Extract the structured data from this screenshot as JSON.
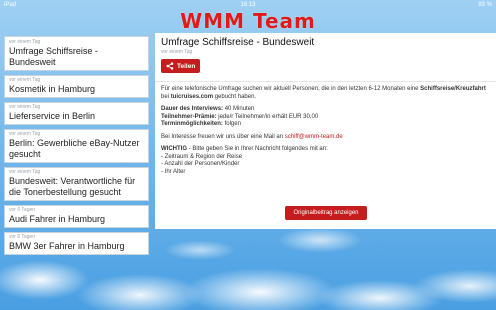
{
  "status": {
    "left": "iPad",
    "time": "16:13",
    "battery": "93 %"
  },
  "app": {
    "title": "WMM Team"
  },
  "sidebar": {
    "items": [
      {
        "when": "vor einem Tag",
        "title": "Umfrage Schiffsreise - Bundesweit"
      },
      {
        "when": "vor einem Tag",
        "title": "Kosmetik in Hamburg"
      },
      {
        "when": "vor einem Tag",
        "title": "Lieferservice in Berlin"
      },
      {
        "when": "vor einem Tag",
        "title": "Berlin: Gewerbliche eBay-Nutzer gesucht"
      },
      {
        "when": "vor einem Tag",
        "title": "Bundesweit: Verantwortliche für die Tonerbestellung gesucht"
      },
      {
        "when": "vor 6 Tagen",
        "title": "Audi Fahrer in Hamburg"
      },
      {
        "when": "vor 6 Tagen",
        "title": "BMW 3er Fahrer in Hamburg"
      }
    ]
  },
  "detail": {
    "title": "Umfrage Schiffsreise - Bundesweit",
    "when": "vor einem Tag",
    "share_label": "Teilen",
    "intro_pre": "Für eine telefonische Umfrage suchen wir aktuell Personen, die in den letzten 6-12 Monaten eine ",
    "intro_bold1": "Schiffsreise/Kreuzfahrt",
    "intro_mid": " bei ",
    "intro_bold2": "tuicruises.com",
    "intro_post": " gebucht haben.",
    "duration_label": "Dauer des Interviews:",
    "duration_value": " 40 Minuten",
    "reward_label": "Teilnehmer-Prämie:",
    "reward_value": " jede/r Teilnehmer/in erhält EUR 30,00",
    "dates_label": "Terminmöglichkeiten:",
    "dates_value": " folgen",
    "contact_pre": "Bei Interesse freuen wir uns über eine Mail an ",
    "contact_mail": "schiff@wmm-team.de",
    "important_label": "WICHTIG",
    "important_text": " - Bitte geben Sie in Ihrer Nachricht folgendes mit an:",
    "bullet1": "- Zeitraum & Region der Reise",
    "bullet2": "- Anzahl der Personen/Kinder",
    "bullet3": "- Ihr Alter",
    "original_button": "Originalbeitrag anzeigen"
  },
  "colors": {
    "accent": "#c51d1d",
    "title": "#e01919"
  },
  "icons": {
    "share": "share-icon"
  }
}
